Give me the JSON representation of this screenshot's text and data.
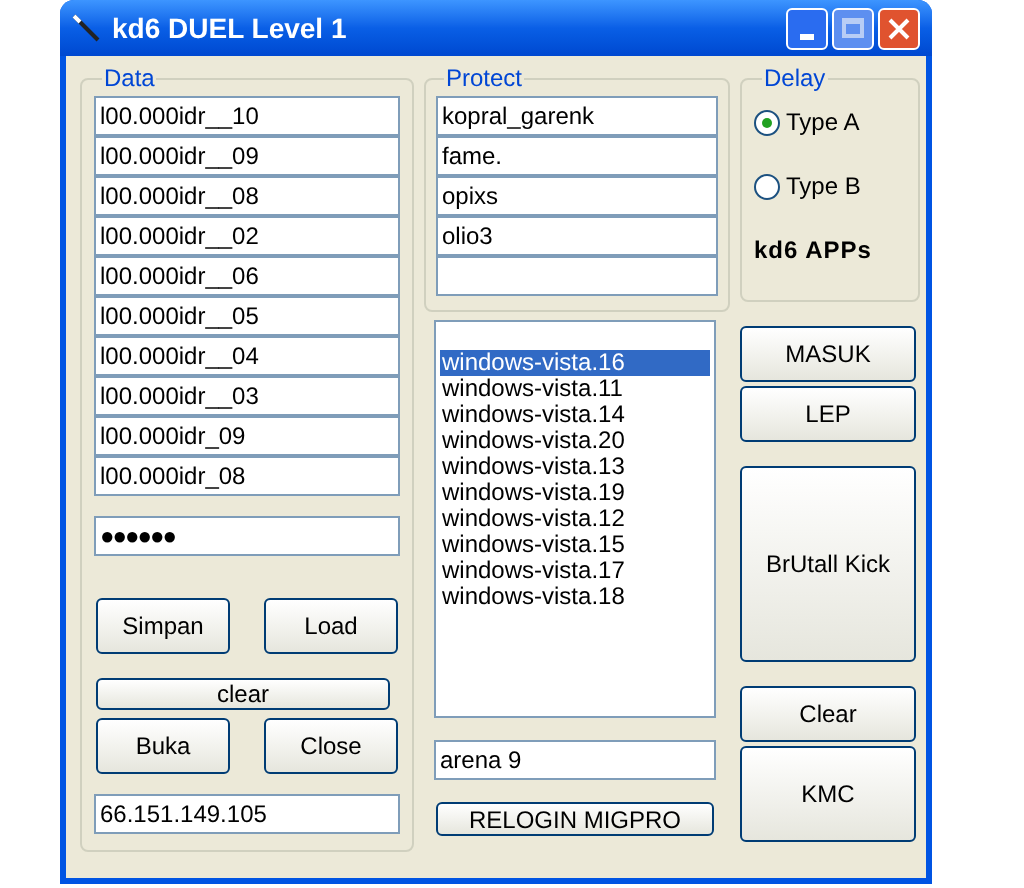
{
  "window": {
    "title": "kd6 DUEL Level 1"
  },
  "data": {
    "label": "Data",
    "accounts": [
      "l00.000idr__10",
      "l00.000idr__09",
      "l00.000idr__08",
      "l00.000idr__02",
      "l00.000idr__06",
      "l00.000idr__05",
      "l00.000idr__04",
      "l00.000idr__03",
      "l00.000idr_09",
      "l00.000idr_08"
    ],
    "password": "●●●●●●",
    "buttons": [
      "Simpan",
      "Load"
    ],
    "clear_button": "clear",
    "buttons_2": [
      "Buka",
      "Close"
    ],
    "server": "66.151.149.105"
  },
  "protect": {
    "label": "Protect",
    "names": [
      "kopral_garenk",
      "fame.",
      "opixs",
      "olio3"
    ]
  },
  "delay": {
    "label": "Delay",
    "options": [
      {
        "label": "Type A",
        "selected": true
      },
      {
        "label": "Type B",
        "selected": false
      }
    ],
    "brand": "kd6 APPs"
  },
  "users": [
    {
      "name": "windows-vista.16",
      "selected": true
    },
    {
      "name": "windows-vista.11",
      "selected": false
    },
    {
      "name": "windows-vista.14",
      "selected": false
    },
    {
      "name": "windows-vista.20",
      "selected": false
    },
    {
      "name": "windows-vista.13",
      "selected": false
    },
    {
      "name": "windows-vista.19",
      "selected": false
    },
    {
      "name": "windows-vista.12",
      "selected": false
    },
    {
      "name": "windows-vista.15",
      "selected": false
    },
    {
      "name": "windows-vista.17",
      "selected": false
    },
    {
      "name": "windows-vista.18",
      "selected": false
    }
  ],
  "room": "arena 9",
  "relogin_button": "RELOGIN MIGPRO",
  "actions": [
    {
      "label": "MASUK",
      "kind": "small"
    },
    {
      "label": "LEP",
      "kind": "small"
    },
    {
      "label": "BrUtall Kick",
      "kind": "large"
    },
    {
      "label": "Clear",
      "kind": "small"
    },
    {
      "label": "KMC",
      "kind": "medium"
    }
  ]
}
